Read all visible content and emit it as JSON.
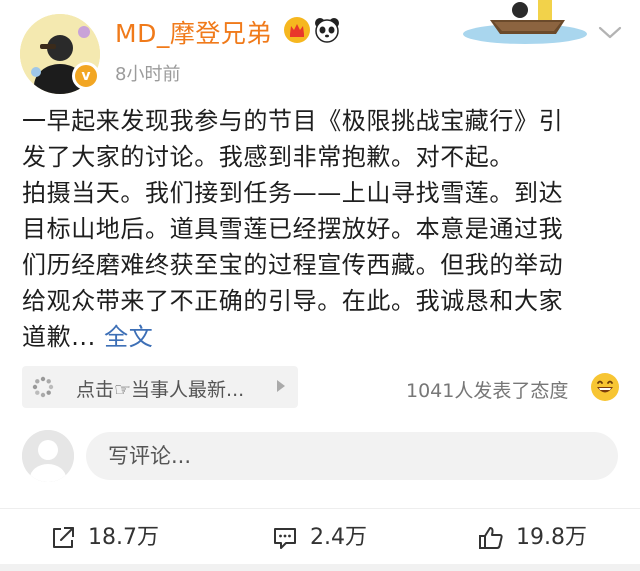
{
  "header": {
    "username": "MD_摩登兄弟",
    "timestamp": "8小时前",
    "verified_badge": "v",
    "icons": [
      "crown-icon",
      "panda-icon",
      "chevron-down-icon"
    ]
  },
  "post": {
    "lines": [
      "一早起来发现我参与的节目《极限挑战宝藏行》引",
      "发了大家的讨论。我感到非常抱歉。对不起。",
      "拍摄当天。我们接到任务——上山寻找雪莲。到达",
      "目标山地后。道具雪莲已经摆放好。本意是通过我",
      "们历经磨难终获至宝的过程宣传西藏。但我的举动",
      "给观众带来了不正确的引导。在此。我诚恳和大家"
    ],
    "last_line": "道歉...",
    "full_text_link": "全文"
  },
  "topic": {
    "text": "点击☞当事人最新...",
    "reactions": "1041人发表了态度"
  },
  "comment": {
    "placeholder": "写评论..."
  },
  "actions": {
    "repost_count": "18.7万",
    "comment_count": "2.4万",
    "like_count": "19.8万"
  },
  "colors": {
    "username": "#f07a1a",
    "link": "#3d6fb6",
    "verified": "#f2a623"
  }
}
